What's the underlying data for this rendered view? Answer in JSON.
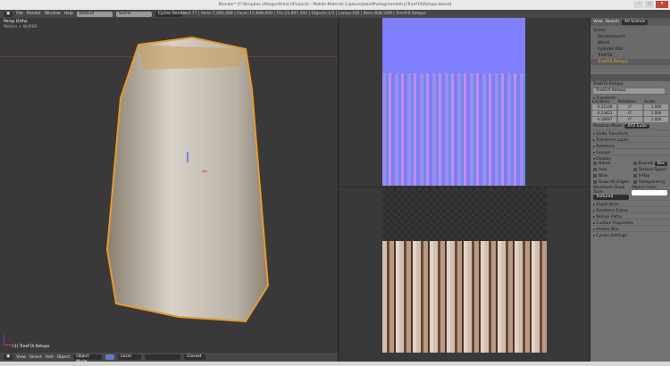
{
  "window": {
    "title": "Blender* [F:\\Dropbox (Allegorithmic)\\Projects - Mobile Material Capture\\Jobs\\Photogrammetry\\TreeFIX\\Retopo.blend]",
    "min": "–",
    "max": "▢",
    "close": "✕"
  },
  "info": {
    "menus": [
      "File",
      "Render",
      "Window",
      "Help"
    ],
    "layout": "Default",
    "scene": "Scene",
    "engine": "Cycles Render",
    "stats": "v2.77 | Verts:7,960,488 | Faces:15,898,000 | Tris:15,897,392 | Objects:1/3 | Lamps:0/0 | Mem:838.50M | TreeFIX.Retopo"
  },
  "viewport": {
    "view_name": "Persp Ortho",
    "units": "Meters + NURBS",
    "object_label": "(1) TreeFIX.Retopo",
    "menus": [
      "View",
      "Select",
      "Add",
      "Object"
    ],
    "mode": "Object Mode",
    "pivot": "Local",
    "snap": "Closest"
  },
  "outliner": {
    "tabs": [
      "View",
      "Search",
      "All Scenes"
    ],
    "items": [
      "Scene",
      "RenderLayers",
      "World",
      "Cylinder.002",
      "TreeFIX",
      "TreeFIX.Retopo"
    ]
  },
  "properties": {
    "breadcrumb": "TreeFIX.Retopo",
    "object_name": "TreeFIX.Retopo",
    "transform": {
      "title": "Transform",
      "loc_label": "Location:",
      "rot_label": "Rotation:",
      "scale_label": "Scale:",
      "location": [
        "-0.52148",
        "-0.13822",
        "-0.18097"
      ],
      "rotation": [
        "0°",
        "0°",
        "0°"
      ],
      "scale": [
        "1.000",
        "1.000",
        "1.000"
      ],
      "rotation_mode_label": "Rotation Mode:",
      "rotation_mode": "XYZ Euler"
    },
    "panels_before": [
      "Delta Transform",
      "Transform Locks",
      "Relations",
      "Groups"
    ],
    "display": {
      "title": "Display",
      "left": [
        "Name",
        "Axis",
        "Wire",
        "Draw All Edges"
      ],
      "right": [
        "Bounds",
        "Texture Space",
        "X-Ray",
        "Transparency"
      ],
      "bounds_type": "Box",
      "max_draw_label": "Maximum Draw Type:",
      "max_draw": "Textured",
      "color_label": "Object Color:"
    },
    "panels_after": [
      "Duplication",
      "Relations Extras",
      "Motion Paths",
      "Custom Properties",
      "Motion Blur",
      "Cycles Settings"
    ]
  },
  "colors": {
    "normal_map": "#8080ff",
    "bg": "#393939",
    "selected": "#f5a623"
  }
}
